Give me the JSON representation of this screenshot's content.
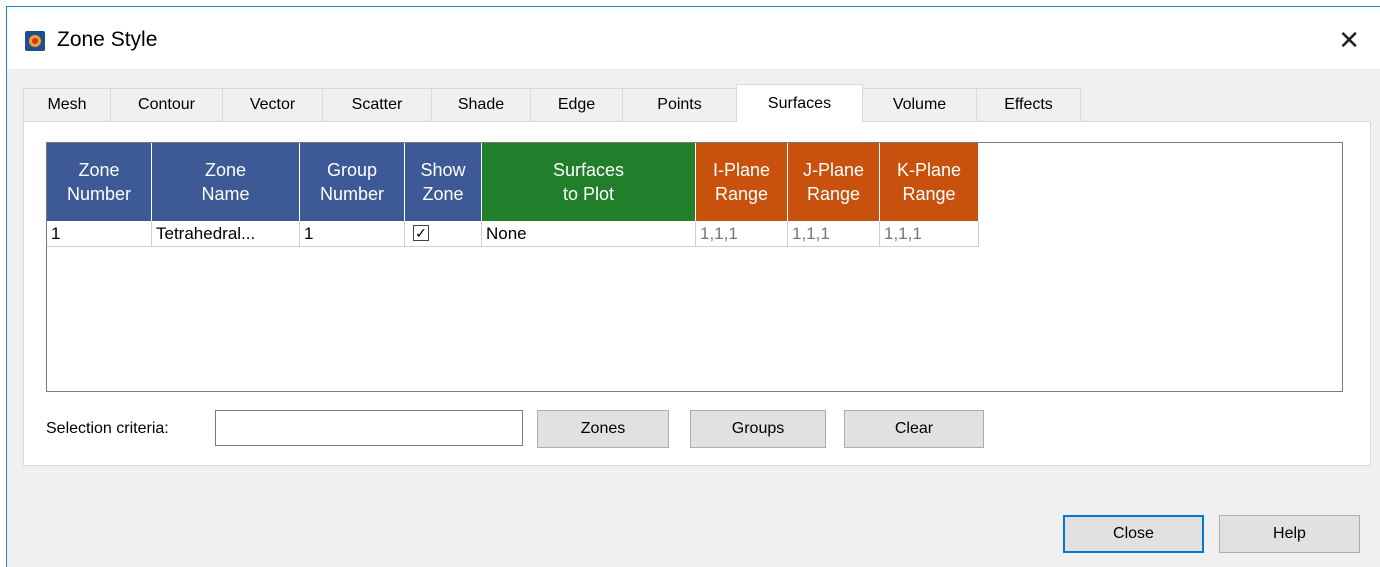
{
  "window": {
    "title": "Zone Style"
  },
  "tabs": [
    {
      "label": "Mesh"
    },
    {
      "label": "Contour"
    },
    {
      "label": "Vector"
    },
    {
      "label": "Scatter"
    },
    {
      "label": "Shade"
    },
    {
      "label": "Edge"
    },
    {
      "label": "Points"
    },
    {
      "label": "Surfaces"
    },
    {
      "label": "Volume"
    },
    {
      "label": "Effects"
    }
  ],
  "active_tab": "Surfaces",
  "table": {
    "headers": [
      {
        "label": "Zone\nNumber",
        "color": "#3e5a96"
      },
      {
        "label": "Zone\nName",
        "color": "#3e5a96"
      },
      {
        "label": "Group\nNumber",
        "color": "#3e5a96"
      },
      {
        "label": "Show\nZone",
        "color": "#3e5a96"
      },
      {
        "label": "Surfaces\nto Plot",
        "color": "#217f2b"
      },
      {
        "label": "I-Plane\nRange",
        "color": "#c8520d"
      },
      {
        "label": "J-Plane\nRange",
        "color": "#c8520d"
      },
      {
        "label": "K-Plane\nRange",
        "color": "#c8520d"
      }
    ],
    "rows": [
      {
        "zone_number": "1",
        "zone_name": "Tetrahedral...",
        "group_number": "1",
        "show_zone": true,
        "surfaces": "None",
        "i_range": "1,1,1",
        "j_range": "1,1,1",
        "k_range": "1,1,1"
      }
    ]
  },
  "selection": {
    "label": "Selection criteria:",
    "value": ""
  },
  "buttons": {
    "zones": "Zones",
    "groups": "Groups",
    "clear": "Clear",
    "close": "Close",
    "help": "Help"
  }
}
